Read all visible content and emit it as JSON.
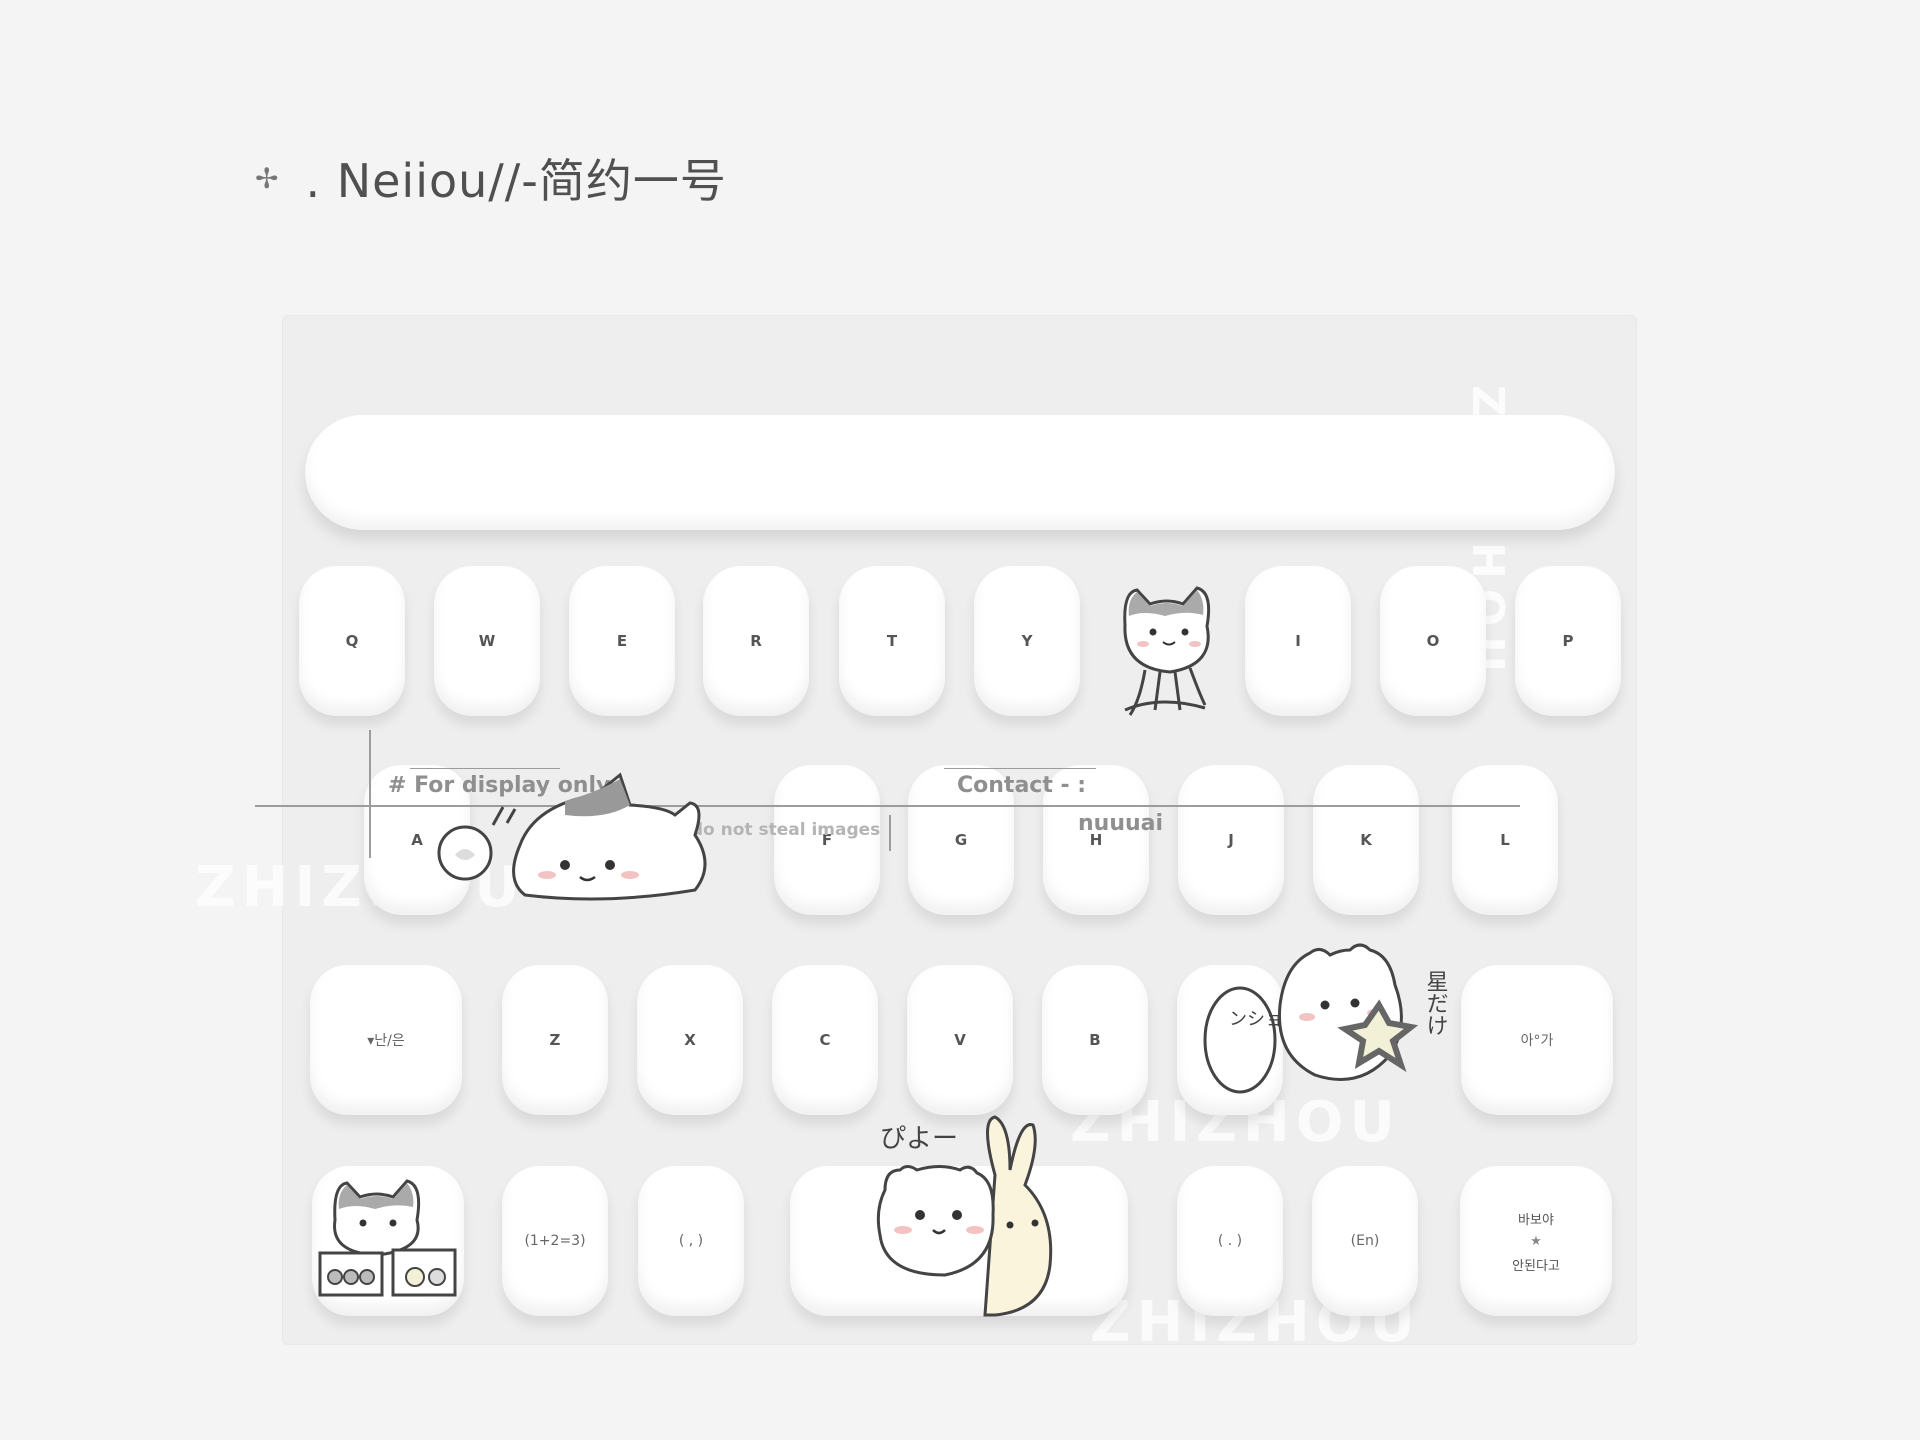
{
  "header": {
    "sparkle_icon": "✢",
    "title": ". Neiiou//-简约一号"
  },
  "watermark": {
    "text": "ZHIZHOU",
    "vertical_right": "ZHIZHOU",
    "vertical_left": "ZHIZHOU"
  },
  "overlay": {
    "display_only": "# For display only",
    "dont_steal": "Please do not steal images",
    "contact_label": "Contact - :",
    "contact_value": "nuuuai"
  },
  "keyboard": {
    "row1": [
      "Q",
      "W",
      "E",
      "R",
      "T",
      "Y",
      "I",
      "O",
      "P"
    ],
    "row2": [
      "A",
      "F",
      "G",
      "H",
      "J",
      "K",
      "L"
    ],
    "row3": [
      "Z",
      "X",
      "C",
      "V",
      "B"
    ],
    "topic_key": "▾난/은",
    "subject_key": "아°가",
    "num_key": "(1+2=3)",
    "comma_key": "( , )",
    "period_key": "( . )",
    "lang_key": "(En)",
    "enter_key_top": "바보야",
    "enter_key_star": "★",
    "enter_key_bottom": "안된다고"
  },
  "stickers": {
    "speech_bubble_text": "ンショ!!",
    "hand_text": "星だけ",
    "piyo_text": "ぴよー"
  },
  "colors": {
    "page_bg": "#f4f4f4",
    "board_bg": "#eeeeee",
    "key_bg": "#ffffff",
    "text": "#555555",
    "sticker_stroke": "#444444",
    "bunny_fill": "#fbf4dc"
  }
}
